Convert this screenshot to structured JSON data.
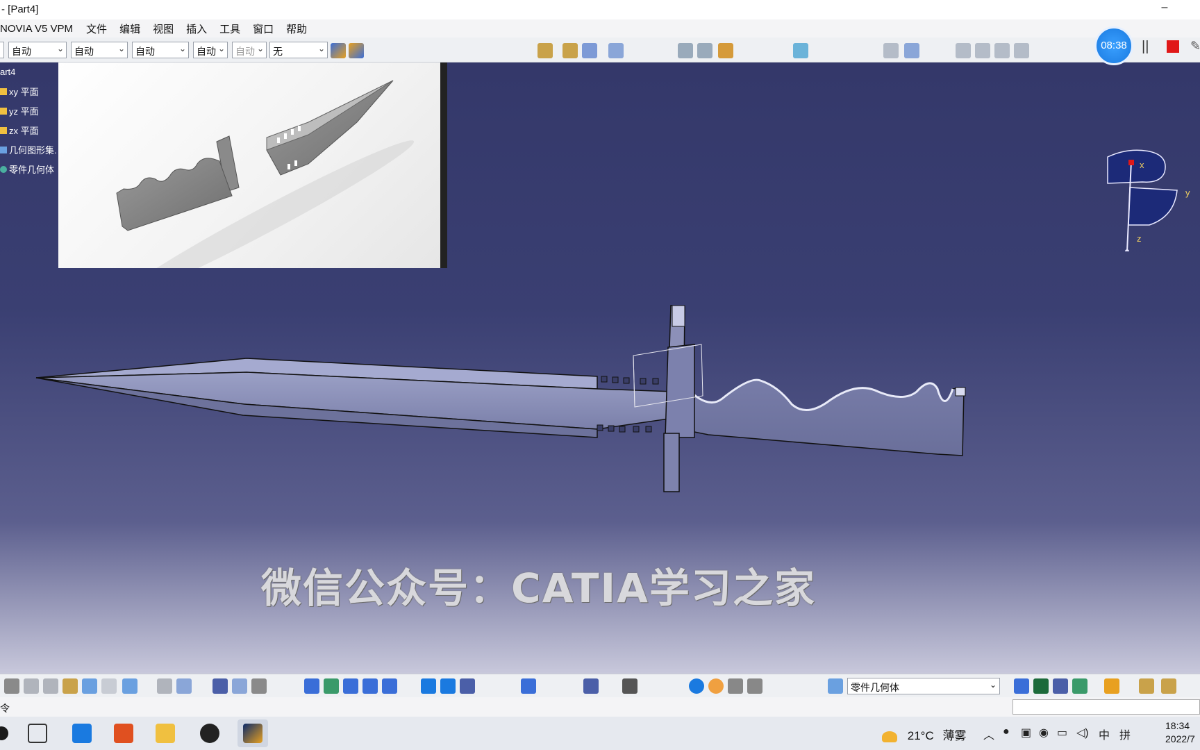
{
  "window": {
    "title": "- [Part4]",
    "minimize": "–"
  },
  "menubar": {
    "app_label": "NOVIA V5 VPM",
    "items": [
      "文件",
      "编辑",
      "视图",
      "插入",
      "工具",
      "窗口",
      "帮助"
    ]
  },
  "toolbar_top": {
    "combos": [
      {
        "value": "自动"
      },
      {
        "value": "自动"
      },
      {
        "value": "自动"
      },
      {
        "value": "自动"
      },
      {
        "value": "自动"
      },
      {
        "value": "无"
      }
    ]
  },
  "tree": {
    "root": "art4",
    "items": [
      "xy 平面",
      "yz 平面",
      "zx 平面",
      "几何图形集.",
      "零件几何体"
    ]
  },
  "compass": {
    "x_label": "x",
    "y_label": "y",
    "z_label": "z"
  },
  "watermark": "微信公众号：CATIA学习之家",
  "recorder": {
    "timer": "08:38"
  },
  "toolbar_bottom": {
    "body_select": "零件几何体"
  },
  "cmdbar": {
    "label": "令"
  },
  "taskbar": {
    "weather_temp": "21°C",
    "weather_desc": "薄雾",
    "ime_lang": "中",
    "ime_mode": "拼",
    "time": "18:34",
    "date": "2022/7"
  },
  "colors": {
    "viewport_top": "#34386a",
    "viewport_bottom": "#c9c9dc",
    "timer_blue": "#1a7ae0",
    "stop_red": "#e01818"
  }
}
